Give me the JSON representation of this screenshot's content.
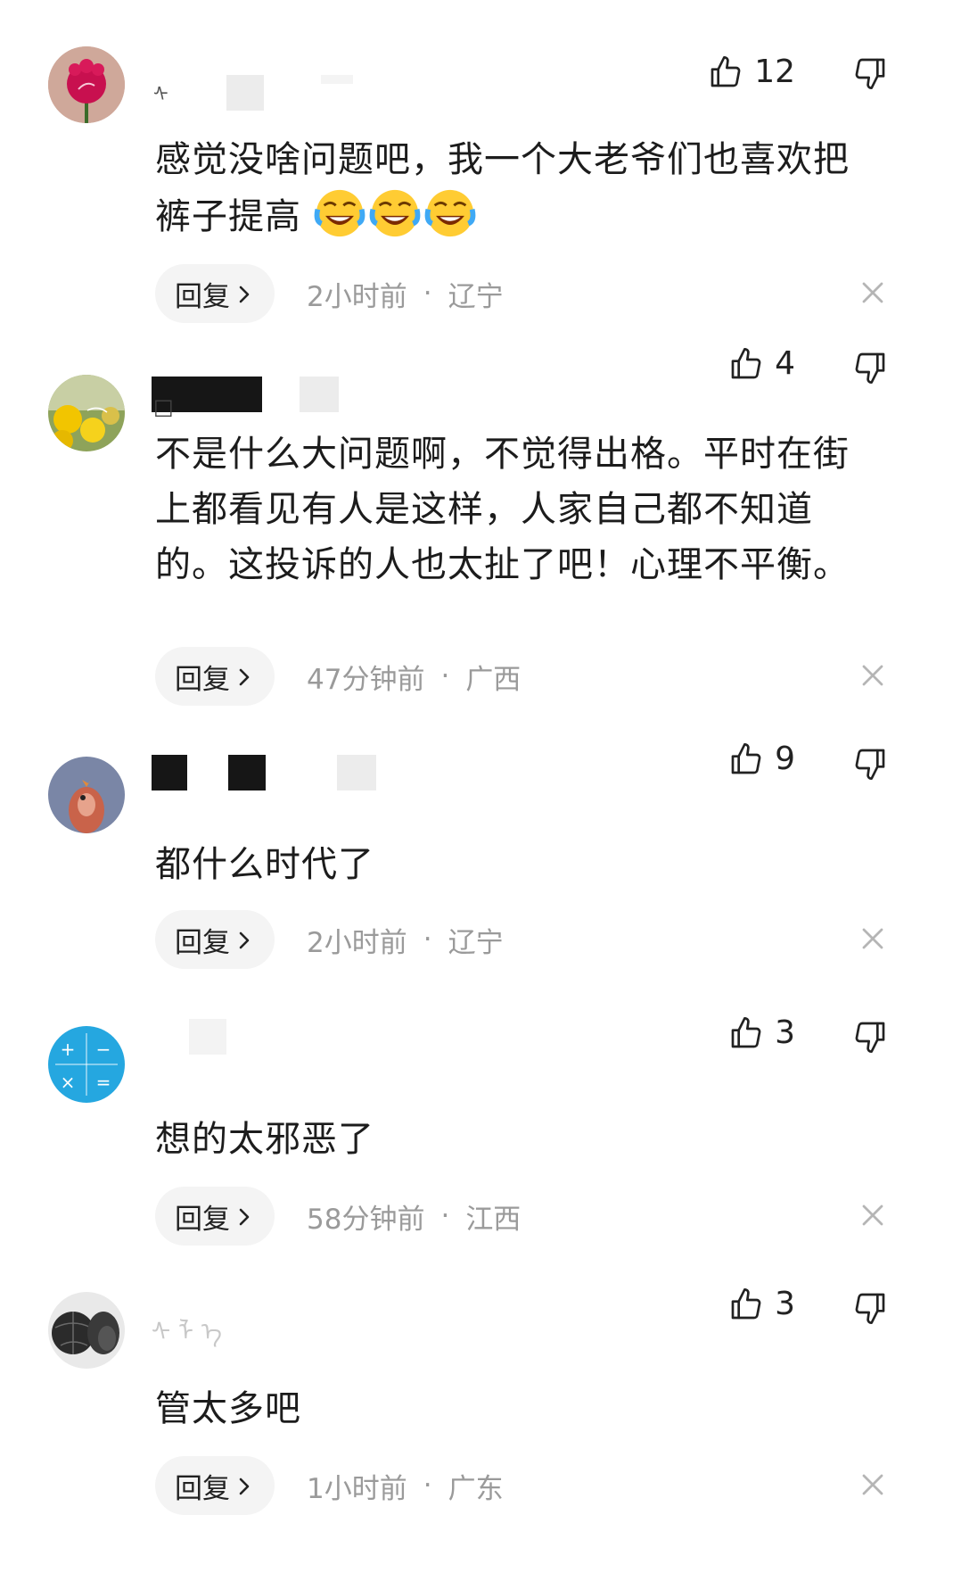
{
  "comments": [
    {
      "likes": "12",
      "text": "感觉没啥问题吧，我一个大老爷们也喜欢把裤子提高",
      "emoji_count": 3,
      "reply": "回复",
      "time": "2小时前",
      "dot": "·",
      "region": "辽宁"
    },
    {
      "likes": "4",
      "text": "不是什么大问题啊，不觉得出格。平时在街上都看见有人是这样，人家自己都不知道的。这投诉的人也太扯了吧！心理不平衡。",
      "reply": "回复",
      "time": "47分钟前",
      "dot": "·",
      "region": "广西"
    },
    {
      "likes": "9",
      "text": "都什么时代了",
      "reply": "回复",
      "time": "2小时前",
      "dot": "·",
      "region": "辽宁"
    },
    {
      "likes": "3",
      "text": "想的太邪恶了",
      "reply": "回复",
      "time": "58分钟前",
      "dot": "·",
      "region": "江西"
    },
    {
      "likes": "3",
      "text": "管太多吧",
      "reply": "回复",
      "time": "1小时前",
      "dot": "·",
      "region": "广东"
    }
  ],
  "icons": {
    "like": "thumbs-up-icon",
    "dislike": "thumbs-down-icon",
    "reply_arrow": "chevron-right-icon",
    "close": "close-icon",
    "emoji": "crying-laughing-emoji"
  }
}
